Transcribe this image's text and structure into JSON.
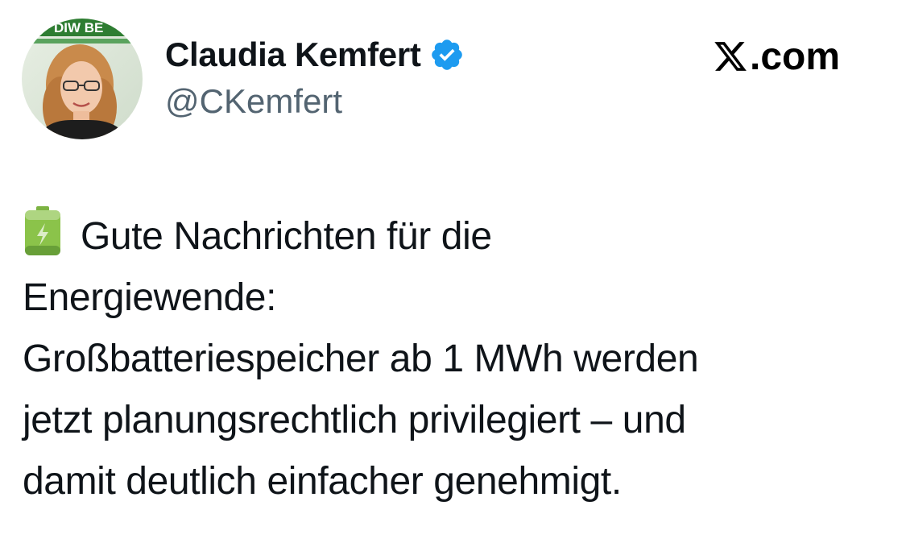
{
  "author": {
    "display_name": "Claudia Kemfert",
    "handle": "@CKemfert",
    "verified_badge": "verified-badge-icon",
    "avatar_banner_text": "DIW BE"
  },
  "site": {
    "label": ".com",
    "logo": "x-logo-icon"
  },
  "tweet": {
    "emoji": "battery-icon",
    "lines": [
      "Gute Nachrichten für die",
      "Energiewende:",
      "Großbatteriespeicher ab 1 MWh werden",
      "jetzt planungsrechtlich privilegiert – und",
      "damit deutlich einfacher genehmigt."
    ]
  },
  "colors": {
    "verified_blue": "#1d9bf0",
    "handle_gray": "#536471",
    "text": "#0f1419",
    "battery_green": "#8bc34a"
  }
}
